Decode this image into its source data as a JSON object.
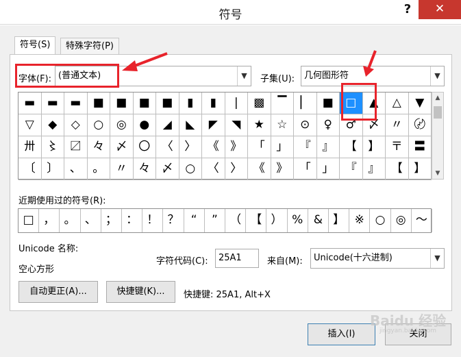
{
  "window": {
    "title": "符号",
    "help_label": "?",
    "close_label": "✕"
  },
  "tabs": [
    {
      "label": "符号(S)",
      "active": true
    },
    {
      "label": "特殊字符(P)",
      "active": false
    }
  ],
  "font": {
    "label": "字体(F):",
    "value": "(普通文本)"
  },
  "subset": {
    "label": "子集(U):",
    "value": "几何图形符"
  },
  "symbol_grid": {
    "rows": [
      [
        "▬",
        "▬",
        "▬",
        "■",
        "■",
        "■",
        "■",
        "▮",
        "▮",
        "❘",
        "▩",
        "▔",
        "▏",
        "■",
        "□",
        "▲",
        "△",
        "▼"
      ],
      [
        "▽",
        "◆",
        "◇",
        "○",
        "◎",
        "●",
        "◢",
        "◣",
        "◤",
        "◥",
        "★",
        "☆",
        "⊙",
        "♀",
        "♂",
        "〆",
        "〃",
        "〄"
      ],
      [
        "〺",
        "〻",
        "〼",
        "々",
        "〆",
        "〇",
        "〈",
        "〉",
        "《",
        "》",
        "「",
        "」",
        "『",
        "』",
        "【",
        "】",
        "〒",
        "〓"
      ],
      [
        "〔",
        "〕",
        "、",
        "。",
        "〃",
        "々",
        "〆",
        "○",
        "〈",
        "〉",
        "《",
        "》",
        "「",
        "」",
        "『",
        "』",
        "【",
        "】"
      ]
    ],
    "selected_row": 0,
    "selected_col": 14
  },
  "recent": {
    "label": "近期使用过的符号(R):",
    "symbols": [
      "□",
      "，",
      "。",
      "、",
      "；",
      "：",
      "！",
      "？",
      "“",
      "”",
      "（",
      "【",
      "）",
      "%",
      "&",
      "】",
      "※",
      "○",
      "◎",
      "～"
    ]
  },
  "unicode_name": {
    "label": "Unicode 名称:",
    "value": "空心方形"
  },
  "char_code": {
    "label": "字符代码(C):",
    "value": "25A1"
  },
  "from": {
    "label": "来自(M):",
    "value": "Unicode(十六进制)"
  },
  "buttons": {
    "autocorrect": "自动更正(A)...",
    "shortcut_key": "快捷键(K)...",
    "insert": "插入(I)",
    "close": "关闭"
  },
  "shortcut_info": "快捷键: 25A1, Alt+X",
  "watermark": {
    "text": "Baidu 经验",
    "sub": "jingyan.baidu.com"
  },
  "colors": {
    "selection": "#1e90ff",
    "annotation": "#e8232b",
    "close_button": "#c7372e"
  }
}
